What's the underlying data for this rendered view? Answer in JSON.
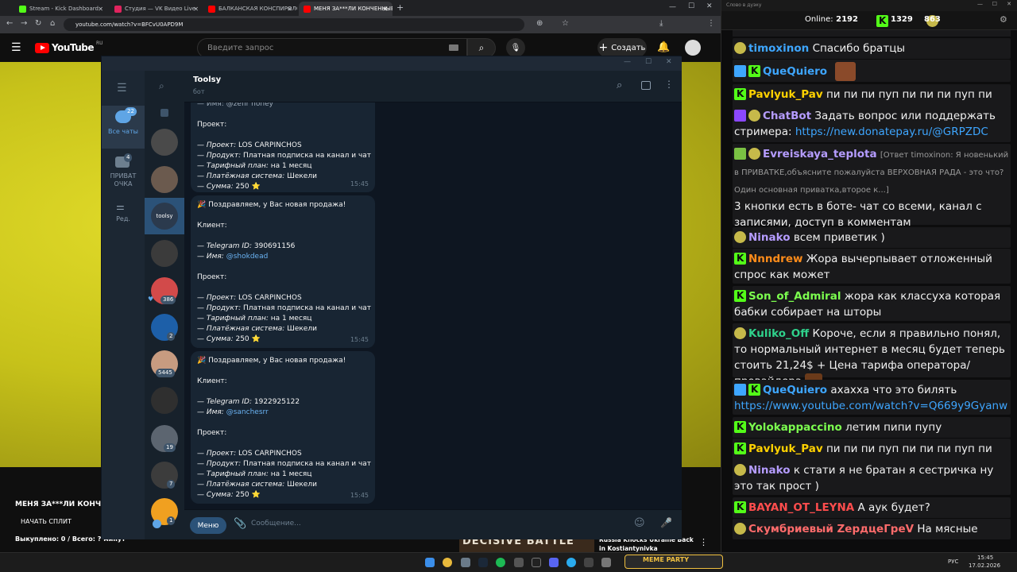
{
  "browser": {
    "tabs": [
      {
        "title": "Stream - Kick Dashboard",
        "color": "#53fc18",
        "active": false
      },
      {
        "title": "Студия — VK Видео Live",
        "color": "#e0245e",
        "active": false
      },
      {
        "title": "БАЛКАНСКАЯ КОНСПИРОЛОГ",
        "color": "#ff0000",
        "active": false
      },
      {
        "title": "МЕНЯ ЗА***ЛИ КОНЧЕННЫЕ С",
        "color": "#ff0000",
        "active": true
      }
    ],
    "url": "youtube.com/watch?v=BFCvU0APD9M"
  },
  "youtube": {
    "logo": "YouTube",
    "region": "RU",
    "search_placeholder": "Введите запрос",
    "create_label": "Создать",
    "video_title": "МЕНЯ ЗА***ЛИ КОНЧЕНН",
    "split_button": "НАЧАТЬ СПЛИТ",
    "bought_text": "Выкуплено: 0 / Всего: ? минут",
    "rec_banner": "DECISIVE BATTLE",
    "rec_title": "Russia Knocks Ukraine Back in Kostiantynivka"
  },
  "telegram": {
    "folders": [
      {
        "label": "Все чаты",
        "badge": "22"
      },
      {
        "label": "ПРИВАТ ОЧКА",
        "badge": "4"
      },
      {
        "label": "Ред.",
        "badge": ""
      }
    ],
    "avatars": [
      {
        "bg": "#4a4a4a",
        "badge": ""
      },
      {
        "bg": "#6b5a4e",
        "badge": ""
      },
      {
        "bg": "#2b3a4d",
        "badge": "",
        "text": "toolsy"
      },
      {
        "bg": "#3b3b3b",
        "badge": ""
      },
      {
        "bg": "#d24a4a",
        "badge": "386"
      },
      {
        "bg": "#1d5fa8",
        "badge": "2"
      },
      {
        "bg": "#c79b80",
        "badge": "5445"
      },
      {
        "bg": "#2f2f2f",
        "badge": ""
      },
      {
        "bg": "#5c6570",
        "badge": "19"
      },
      {
        "bg": "#3c3c3c",
        "badge": "7"
      },
      {
        "bg": "#f0a020",
        "badge": "1"
      }
    ],
    "chat_name": "Toolsy",
    "chat_status": "бот",
    "first_partial": {
      "cut_line": "— Имя: @zefir honey",
      "project_label": "Проект:",
      "lines": [
        {
          "k": "— Проект:",
          "v": "LOS CARPINCHOS"
        },
        {
          "k": "— Продукт:",
          "v": "Платная подписка на канал и чат"
        },
        {
          "k": "— Тарифный план:",
          "v": "на 1 месяц"
        },
        {
          "k": "— Платёжная система:",
          "v": "Шекели"
        },
        {
          "k": "— Сумма:",
          "v": "250 ⭐"
        }
      ],
      "time": "15:45"
    },
    "sales": [
      {
        "headline": "🎉 Поздравляем, у Вас новая продажа!",
        "client_label": "Клиент:",
        "tg_id_label": "— Telegram ID:",
        "tg_id": "390691156",
        "name_label": "— Имя:",
        "name": "@shokdead",
        "project_label": "Проект:",
        "lines": [
          {
            "k": "— Проект:",
            "v": "LOS CARPINCHOS"
          },
          {
            "k": "— Продукт:",
            "v": "Платная подписка на канал и чат"
          },
          {
            "k": "— Тарифный план:",
            "v": "на 1 месяц"
          },
          {
            "k": "— Платёжная система:",
            "v": "Шекели"
          },
          {
            "k": "— Сумма:",
            "v": "250 ⭐"
          }
        ],
        "time": "15:45"
      },
      {
        "headline": "🎉 Поздравляем, у Вас новая продажа!",
        "client_label": "Клиент:",
        "tg_id_label": "— Telegram ID:",
        "tg_id": "1922925122",
        "name_label": "— Имя:",
        "name": "@sanchesrr",
        "project_label": "Проект:",
        "lines": [
          {
            "k": "— Проект:",
            "v": "LOS CARPINCHOS"
          },
          {
            "k": "— Продукт:",
            "v": "Платная подписка на канал и чат"
          },
          {
            "k": "— Тарифный план:",
            "v": "на 1 месяц"
          },
          {
            "k": "— Платёжная система:",
            "v": "Шекели"
          },
          {
            "k": "— Сумма:",
            "v": "250 ⭐"
          }
        ],
        "time": "15:45"
      }
    ],
    "menu_button": "Меню",
    "input_placeholder": "Сообщение..."
  },
  "chat": {
    "window_title": "Слово в дуэку",
    "online_label": "Online:",
    "online_count": "2192",
    "kick_count": "1329",
    "other_count": "863",
    "messages": [
      {
        "icons": [
          "f"
        ],
        "user": "timoxinon",
        "color": "#3ea6ff",
        "text": "Спасибо братцы"
      },
      {
        "icons": [
          "s",
          "k"
        ],
        "user": "QueQuiero",
        "color": "#3ea6ff",
        "text": "",
        "emote": true
      },
      {
        "icons": [
          "k"
        ],
        "user": "Pavlyuk_Pav",
        "color": "#ffd100",
        "text": "пи пи пи пуп пи пи пи пуп пи пип"
      },
      {
        "icons": [
          "p",
          "f"
        ],
        "user": "ChatBot",
        "color": "#b59cff",
        "text": "Задать вопрос или поддержать стримера:",
        "link": "https://new.donatepay.ru/@GRPZDC"
      },
      {
        "icons": [
          "g",
          "f"
        ],
        "user": "Evreiskaya_teplota",
        "color": "#b59cff",
        "reply": "[Ответ timoxinon: Я новенький в ПРИВАТКЕ,объясните пожалуйста ВЕРХОВНАЯ РАДА - это что?Один основная приватка,второе к...]",
        "text": "3 кнопки есть в боте- чат со всеми, канал с записями, доступ в комментам"
      },
      {
        "icons": [
          "f"
        ],
        "user": "Ninako",
        "color": "#b59cff",
        "text": "всем приветик )"
      },
      {
        "icons": [
          "k"
        ],
        "user": "Nnndrew",
        "color": "#ff8c1a",
        "text": "Жора вычерпывает отложенный спрос как может"
      },
      {
        "icons": [
          "k"
        ],
        "user": "Son_of_Admiral",
        "color": "#7cff4f",
        "text": "жора как классуха которая бабки собирает на шторы"
      },
      {
        "icons": [
          "f"
        ],
        "user": "Kuliko_Off",
        "color": "#2fd18b",
        "text": "Короче, если я правильно понял, то нормальный интернет в месяц будет теперь стоить 21,24$ + Цена тарифа оператора/провайдера"
      },
      {
        "icons": [
          "s",
          "k"
        ],
        "user": "QueQuiero",
        "color": "#3ea6ff",
        "text": "ахахха что это билять",
        "link": "https://www.youtube.com/watch?v=Q669y9Gyanw"
      },
      {
        "icons": [
          "k"
        ],
        "user": "Yolokappaccino",
        "color": "#7cff4f",
        "text": "летим пипи пупу"
      },
      {
        "icons": [
          "k"
        ],
        "user": "Pavlyuk_Pav",
        "color": "#ffd100",
        "text": "пи пи пи пуп пи пи пи пуп пи пип"
      },
      {
        "icons": [
          "f"
        ],
        "user": "Ninako",
        "color": "#b59cff",
        "text": "к стати я не братан я сестричка ну это так прост )"
      },
      {
        "icons": [
          "k"
        ],
        "user": "BAYAN_OT_LEYNA",
        "color": "#ff4d4d",
        "text": "А аук будет?"
      },
      {
        "icons": [
          "f"
        ],
        "user": "Скумбриевый ZердцеГреV",
        "color": "#ff6b6b",
        "text": "На мясные"
      }
    ]
  },
  "taskbar": {
    "lang": "РУС",
    "time": "15:45",
    "date": "17.02.2026",
    "meme_party": "MEME PARTY"
  },
  "accent": "#2b5278"
}
